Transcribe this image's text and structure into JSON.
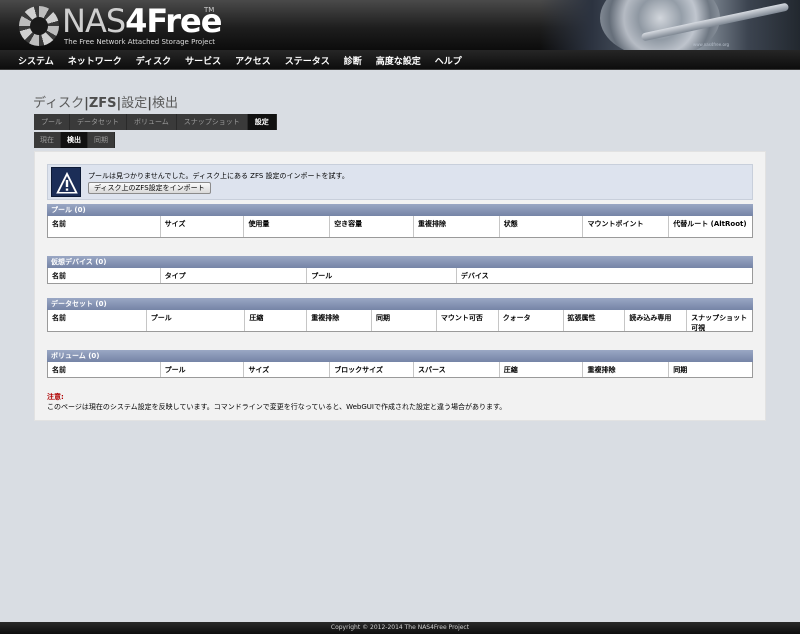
{
  "header": {
    "logo_main": "NAS",
    "logo_bold": "4Free",
    "logo_tm": "TM",
    "tagline": "The Free Network Attached Storage Project",
    "hdd_label": "www.nas4free.org"
  },
  "menu": [
    "システム",
    "ネットワーク",
    "ディスク",
    "サービス",
    "アクセス",
    "ステータス",
    "診断",
    "高度な設定",
    "ヘルプ"
  ],
  "breadcrumb": {
    "part1": "ディスク",
    "sep1": "|",
    "part2": "ZFS",
    "sep2": "|",
    "part3": "設定",
    "sep3": "|",
    "part4": "検出"
  },
  "tabs": [
    {
      "label": "プール",
      "active": false
    },
    {
      "label": "データセット",
      "active": false
    },
    {
      "label": "ボリューム",
      "active": false
    },
    {
      "label": "スナップショット",
      "active": false
    },
    {
      "label": "設定",
      "active": true
    }
  ],
  "subtabs": [
    {
      "label": "現在",
      "active": false
    },
    {
      "label": "検出",
      "active": true
    },
    {
      "label": "同期",
      "active": false
    }
  ],
  "info": {
    "message": "プールは見つかりませんでした。ディスク上にある ZFS 設定のインポートを試す。",
    "button": "ディスク上のZFS設定をインポート"
  },
  "sections": [
    {
      "title": "プール (0)",
      "columns": [
        "名前",
        "サイズ",
        "使用量",
        "空き容量",
        "重複排除",
        "状態",
        "マウントポイント",
        "代替ルート (AltRoot)"
      ]
    },
    {
      "title": "仮想デバイス (0)",
      "columns": [
        "名前",
        "タイプ",
        "プール",
        "デバイス"
      ]
    },
    {
      "title": "データセット (0)",
      "columns": [
        "名前",
        "プール",
        "圧縮",
        "重複排除",
        "同期",
        "マウント可否",
        "クォータ",
        "拡張属性",
        "読み込み専用",
        "スナップショット可視"
      ]
    },
    {
      "title": "ボリューム (0)",
      "columns": [
        "名前",
        "プール",
        "サイズ",
        "ブロックサイズ",
        "スパース",
        "圧縮",
        "重複排除",
        "同期"
      ]
    }
  ],
  "note": {
    "title": "注意:",
    "text": "このページは現在のシステム設定を反映しています。コマンドラインで変更を行なっていると、WebGUIで作成された設定と違う場合があります。"
  },
  "footer": "Copyright © 2012-2014 The NAS4Free Project"
}
